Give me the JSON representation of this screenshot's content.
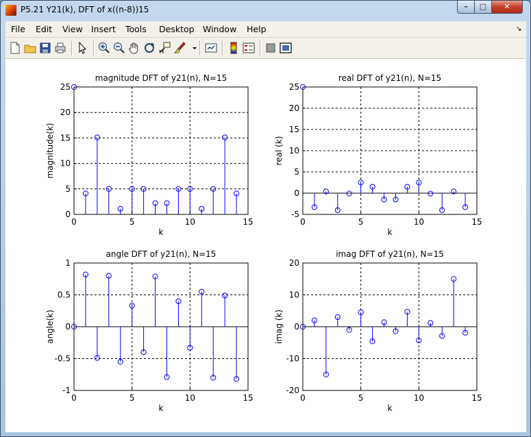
{
  "window": {
    "title": "P5.21 Y21(k), DFT of x((n-8))15",
    "min_glyph": "–",
    "max_glyph": "□",
    "close_glyph": "✕"
  },
  "menu": {
    "items": [
      "File",
      "Edit",
      "View",
      "Insert",
      "Tools",
      "Desktop",
      "Window",
      "Help"
    ],
    "dock_glyph": "↘"
  },
  "toolbar": {
    "icons": [
      "new-figure-icon",
      "open-file-icon",
      "save-icon",
      "print-icon",
      "edit-plot-arrow-icon",
      "zoom-in-icon",
      "zoom-out-icon",
      "pan-hand-icon",
      "rotate-3d-icon",
      "data-cursor-icon",
      "brush-icon",
      "brush-dropdown-icon",
      "link-plot-icon",
      "colorbar-icon",
      "legend-icon",
      "hide-plot-tools-icon",
      "show-plot-tools-icon"
    ]
  },
  "colors": {
    "stem": "#0000ff",
    "axis": "#000000",
    "grid": "#000000"
  },
  "chart_data": [
    {
      "type": "stem",
      "title": "magnitude DFT of y21(n), N=15",
      "xlabel": "k",
      "ylabel": "magnitude(k)",
      "xlim": [
        0,
        15
      ],
      "ylim": [
        0,
        25
      ],
      "xticks": [
        0,
        5,
        10,
        15
      ],
      "yticks": [
        0,
        5,
        10,
        15,
        20,
        25
      ],
      "grid": true,
      "baseline": false,
      "x": [
        0,
        1,
        2,
        3,
        4,
        5,
        6,
        7,
        8,
        9,
        10,
        11,
        12,
        13,
        14
      ],
      "values": [
        25,
        4.1,
        15.1,
        5.0,
        1.1,
        5.0,
        5.0,
        2.2,
        2.2,
        5.0,
        5.0,
        1.1,
        5.0,
        15.1,
        4.1
      ]
    },
    {
      "type": "stem",
      "title": "real DFT of y21(n), N=15",
      "xlabel": "k",
      "ylabel": "real (k)",
      "xlim": [
        0,
        15
      ],
      "ylim": [
        -5,
        25
      ],
      "xticks": [
        0,
        5,
        10,
        15
      ],
      "yticks": [
        -5,
        0,
        5,
        10,
        15,
        20,
        25
      ],
      "grid": true,
      "baseline": true,
      "x": [
        0,
        1,
        2,
        3,
        4,
        5,
        6,
        7,
        8,
        9,
        10,
        11,
        12,
        13,
        14
      ],
      "values": [
        25,
        -3.3,
        0.4,
        -4.0,
        -0.1,
        2.5,
        1.5,
        -1.5,
        -1.5,
        1.5,
        2.5,
        -0.1,
        -4.0,
        0.4,
        -3.3
      ]
    },
    {
      "type": "stem",
      "title": "angle DFT of y21(n), N=15",
      "xlabel": "k",
      "ylabel": "angle(k)",
      "xlim": [
        0,
        15
      ],
      "ylim": [
        -1,
        1
      ],
      "xticks": [
        0,
        5,
        10,
        15
      ],
      "yticks": [
        -1,
        -0.5,
        0,
        0.5,
        1
      ],
      "grid": true,
      "baseline": true,
      "x": [
        0,
        1,
        2,
        3,
        4,
        5,
        6,
        7,
        8,
        9,
        10,
        11,
        12,
        13,
        14
      ],
      "values": [
        0,
        0.82,
        -0.49,
        0.8,
        -0.55,
        0.33,
        -0.4,
        0.79,
        -0.79,
        0.4,
        -0.33,
        0.55,
        -0.8,
        0.49,
        -0.82
      ]
    },
    {
      "type": "stem",
      "title": "imag DFT of y21(n), N=15",
      "xlabel": "k",
      "ylabel": "imag (k)",
      "xlim": [
        0,
        15
      ],
      "ylim": [
        -20,
        20
      ],
      "xticks": [
        0,
        5,
        10,
        15
      ],
      "yticks": [
        -20,
        -10,
        0,
        10,
        20
      ],
      "grid": true,
      "baseline": true,
      "x": [
        0,
        1,
        2,
        3,
        4,
        5,
        6,
        7,
        8,
        9,
        10,
        11,
        12,
        13,
        14
      ],
      "values": [
        0,
        2.0,
        -15.0,
        3.0,
        -1.0,
        4.5,
        -4.6,
        1.4,
        -1.4,
        4.7,
        -4.3,
        1.2,
        -2.9,
        15.0,
        -1.9
      ]
    }
  ]
}
